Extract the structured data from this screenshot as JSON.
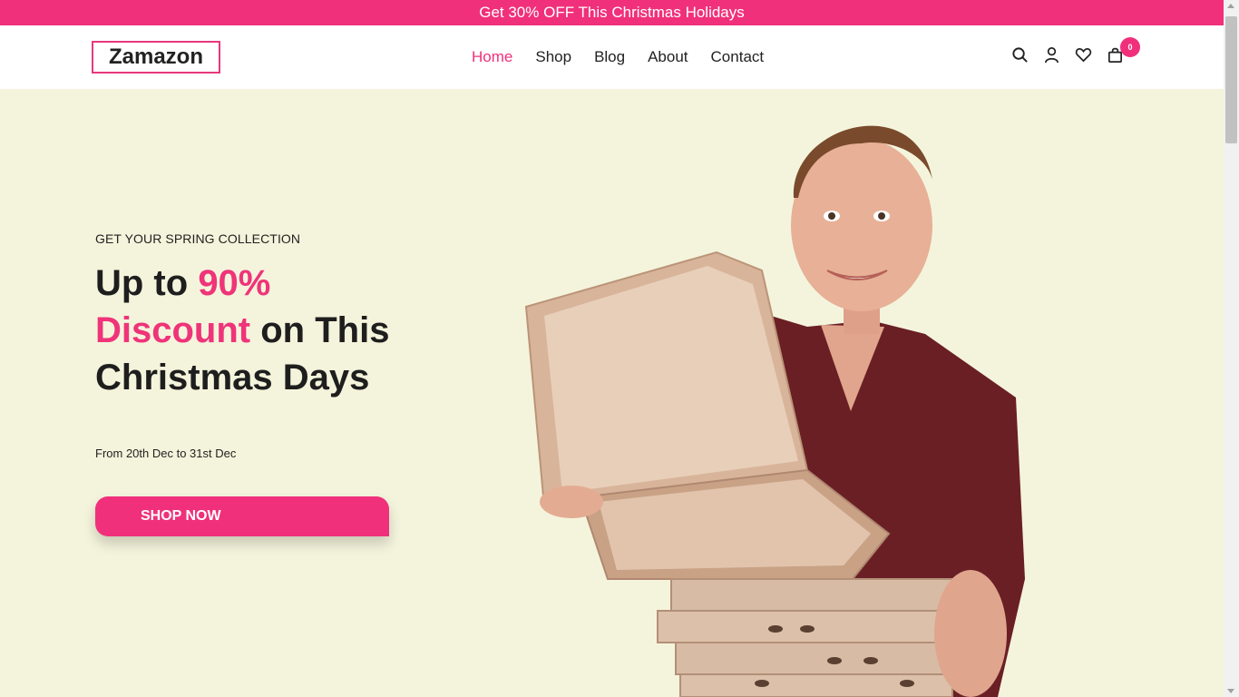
{
  "promo": {
    "text": "Get 30% OFF This Christmas Holidays"
  },
  "header": {
    "logo": "Zamazon",
    "nav": [
      "Home",
      "Shop",
      "Blog",
      "About",
      "Contact"
    ],
    "active_nav": "Home",
    "cart_count": "0",
    "icons": [
      "search-icon",
      "user-icon",
      "heart-icon",
      "cart-icon"
    ]
  },
  "hero": {
    "kicker": "GET YOUR SPRING COLLECTION",
    "title": {
      "part1": "Up to ",
      "highlight1": "90%",
      "highlight2": "Discount",
      "part2": " on This Christmas Days"
    },
    "date_text": "From 20th Dec to 31st Dec",
    "cta": "SHOP NOW",
    "image": "young man in maroon t-shirt holding stack of pizza boxes"
  },
  "colors": {
    "accent": "#f0307b",
    "hero_bg": "#f4f4dc",
    "text": "#1e1e1e"
  }
}
